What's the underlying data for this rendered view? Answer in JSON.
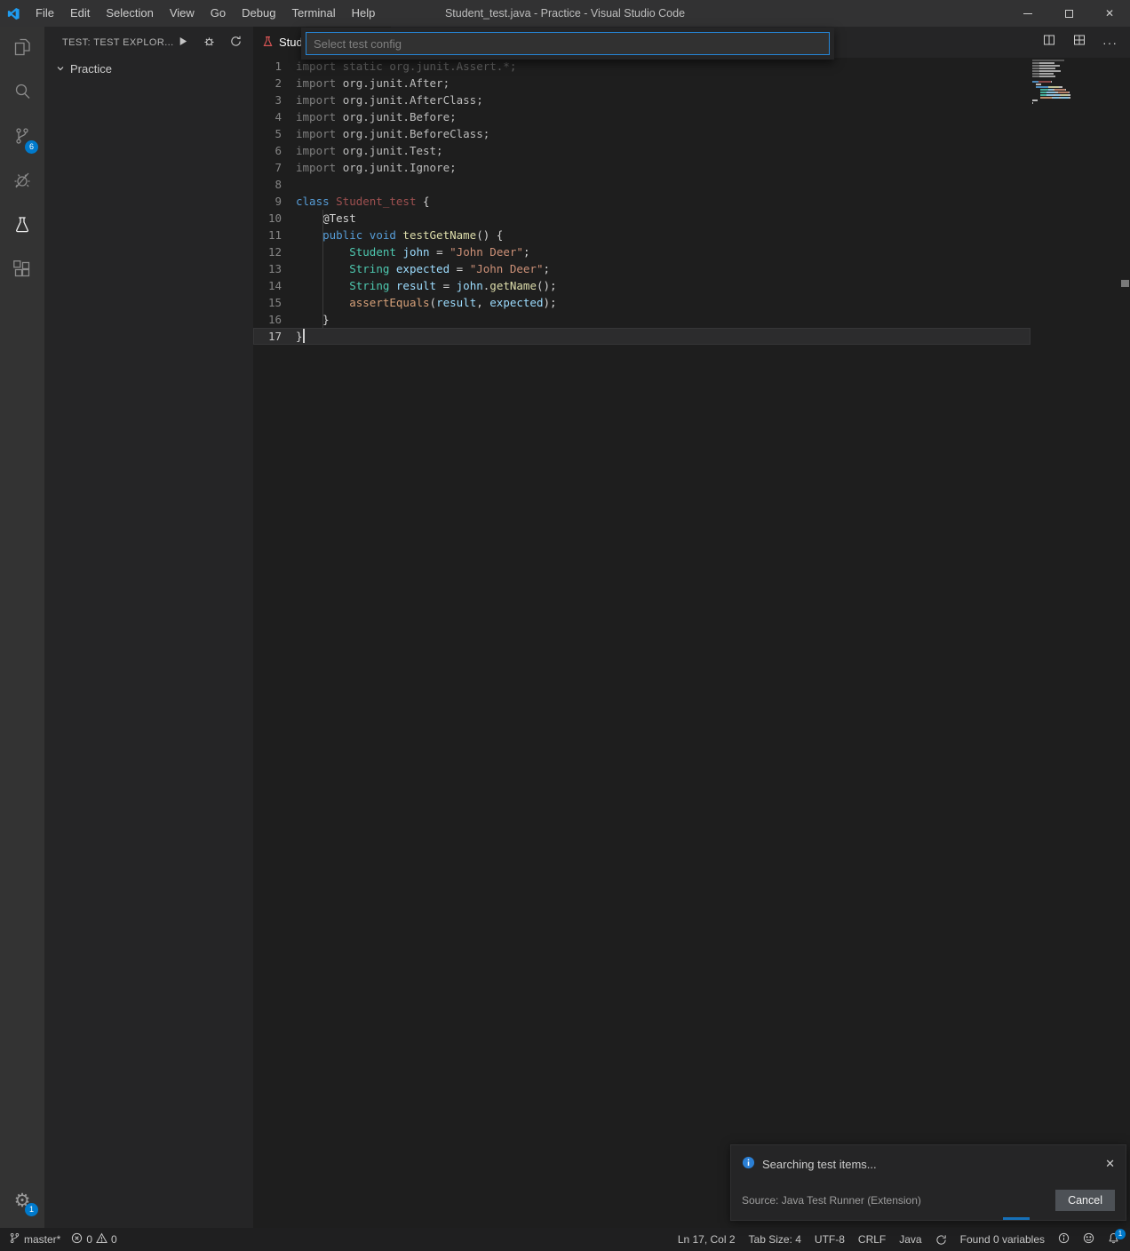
{
  "window": {
    "title": "Student_test.java - Practice - Visual Studio Code",
    "menus": [
      "File",
      "Edit",
      "Selection",
      "View",
      "Go",
      "Debug",
      "Terminal",
      "Help"
    ]
  },
  "icons": {
    "close": "✕",
    "more": "···",
    "gear": "⚙"
  },
  "colors": {
    "accent": "#007acc",
    "focus_border": "#2586d7",
    "activity_badge": "#007acc",
    "info_icon": "#2b7fd4"
  },
  "activity_bar": {
    "scm_badge": "6",
    "settings_badge": "1"
  },
  "sidebar": {
    "title": "TEST: TEST EXPLOR...",
    "tree_item": "Practice"
  },
  "quick_input": {
    "placeholder": "Select test config"
  },
  "editor": {
    "tab_label": "Student_test.java",
    "lines": [
      {
        "n": 1,
        "t": [
          [
            "dim",
            "import static org.junit.Assert.*;"
          ]
        ]
      },
      {
        "n": 2,
        "t": [
          [
            "imp",
            "import "
          ],
          [
            "pkg",
            "org.junit.After;"
          ]
        ]
      },
      {
        "n": 3,
        "t": [
          [
            "imp",
            "import "
          ],
          [
            "pkg",
            "org.junit.AfterClass;"
          ]
        ]
      },
      {
        "n": 4,
        "t": [
          [
            "imp",
            "import "
          ],
          [
            "pkg",
            "org.junit.Before;"
          ]
        ]
      },
      {
        "n": 5,
        "t": [
          [
            "imp",
            "import "
          ],
          [
            "pkg",
            "org.junit.BeforeClass;"
          ]
        ]
      },
      {
        "n": 6,
        "t": [
          [
            "imp",
            "import "
          ],
          [
            "pkg",
            "org.junit.Test;"
          ]
        ]
      },
      {
        "n": 7,
        "t": [
          [
            "imp",
            "import "
          ],
          [
            "pkg",
            "org.junit.Ignore;"
          ]
        ]
      },
      {
        "n": 8,
        "t": []
      },
      {
        "n": 9,
        "t": [
          [
            "kw",
            "class "
          ],
          [
            "cls",
            "Student_test "
          ],
          [
            "pun",
            "{"
          ]
        ]
      },
      {
        "n": 10,
        "t": [
          [
            "pun",
            "    "
          ],
          [
            "ann",
            "@Test"
          ]
        ]
      },
      {
        "n": 11,
        "t": [
          [
            "pun",
            "    "
          ],
          [
            "kw",
            "public void "
          ],
          [
            "fn",
            "testGetName"
          ],
          [
            "pun",
            "() {"
          ]
        ]
      },
      {
        "n": 12,
        "t": [
          [
            "pun",
            "        "
          ],
          [
            "typ",
            "Student "
          ],
          [
            "var",
            "john "
          ],
          [
            "pun",
            "= "
          ],
          [
            "str",
            "\"John Deer\""
          ],
          [
            "pun",
            ";"
          ]
        ]
      },
      {
        "n": 13,
        "t": [
          [
            "pun",
            "        "
          ],
          [
            "typ",
            "String "
          ],
          [
            "var",
            "expected "
          ],
          [
            "pun",
            "= "
          ],
          [
            "str",
            "\"John Deer\""
          ],
          [
            "pun",
            ";"
          ]
        ]
      },
      {
        "n": 14,
        "t": [
          [
            "pun",
            "        "
          ],
          [
            "typ",
            "String "
          ],
          [
            "var",
            "result "
          ],
          [
            "pun",
            "= "
          ],
          [
            "var",
            "john"
          ],
          [
            "pun",
            "."
          ],
          [
            "fn",
            "getName"
          ],
          [
            "pun",
            "();"
          ]
        ]
      },
      {
        "n": 15,
        "t": [
          [
            "pun",
            "        "
          ],
          [
            "fnw",
            "assertEquals"
          ],
          [
            "pun",
            "("
          ],
          [
            "var",
            "result"
          ],
          [
            "pun",
            ", "
          ],
          [
            "var",
            "expected"
          ],
          [
            "pun",
            ");"
          ]
        ]
      },
      {
        "n": 16,
        "t": [
          [
            "pun",
            "    }"
          ]
        ]
      },
      {
        "n": 17,
        "t": [
          [
            "pun",
            "}"
          ]
        ],
        "cur": true
      }
    ]
  },
  "notification": {
    "message": "Searching test items...",
    "source": "Source: Java Test Runner (Extension)",
    "cancel": "Cancel"
  },
  "status_bar": {
    "branch": "master*",
    "errors": "0",
    "warnings": "0",
    "line_col": "Ln 17, Col 2",
    "tab_size": "Tab Size: 4",
    "encoding": "UTF-8",
    "eol": "CRLF",
    "language": "Java",
    "variables": "Found 0 variables",
    "bell_count": "1"
  }
}
